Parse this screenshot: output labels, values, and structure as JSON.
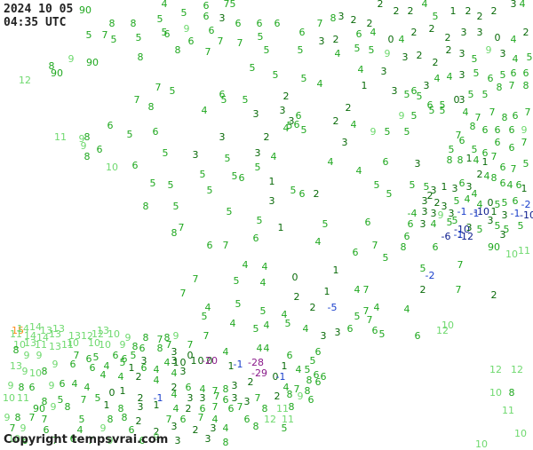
{
  "header": {
    "date": "2024 10 05",
    "time": "04:35 UTC"
  },
  "footer": {
    "copyright": "Copyright tempsvrai.com"
  },
  "colors": {
    "dark_green": "#0a6b0a",
    "green": "#1fa81f",
    "light_green": "#6fd96f",
    "pale_green": "#9fe89f",
    "orange": "#ff8c1a",
    "blue": "#1a3fcc",
    "dark_blue": "#0a1a8c",
    "purple": "#8a1a8a"
  },
  "observation_counts": {
    "2": "#0a6b0a",
    "3": "#0a6b0a",
    "4": "#1fa81f",
    "5": "#1fa81f",
    "6": "#1fa81f",
    "7": "#1fa81f",
    "8": "#1fa81f",
    "9": "#6fd96f",
    "10": "#6fd96f",
    "11": "#6fd96f",
    "12": "#6fd96f",
    "13": "#6fd96f",
    "14": "#6fd96f",
    "15": "#ff8c1a",
    "1": "#0a6b0a",
    "0": "#0a6b0a",
    "-1": "#1a3fcc",
    "-2": "#1a3fcc",
    "-5": "#1a3fcc",
    "-6": "#0a1a8c",
    "-10": "#0a1a8c",
    "-12": "#0a1a8c",
    "-20": "#8a1a8a",
    "-28": "#8a1a8a",
    "-29": "#8a1a8a"
  }
}
